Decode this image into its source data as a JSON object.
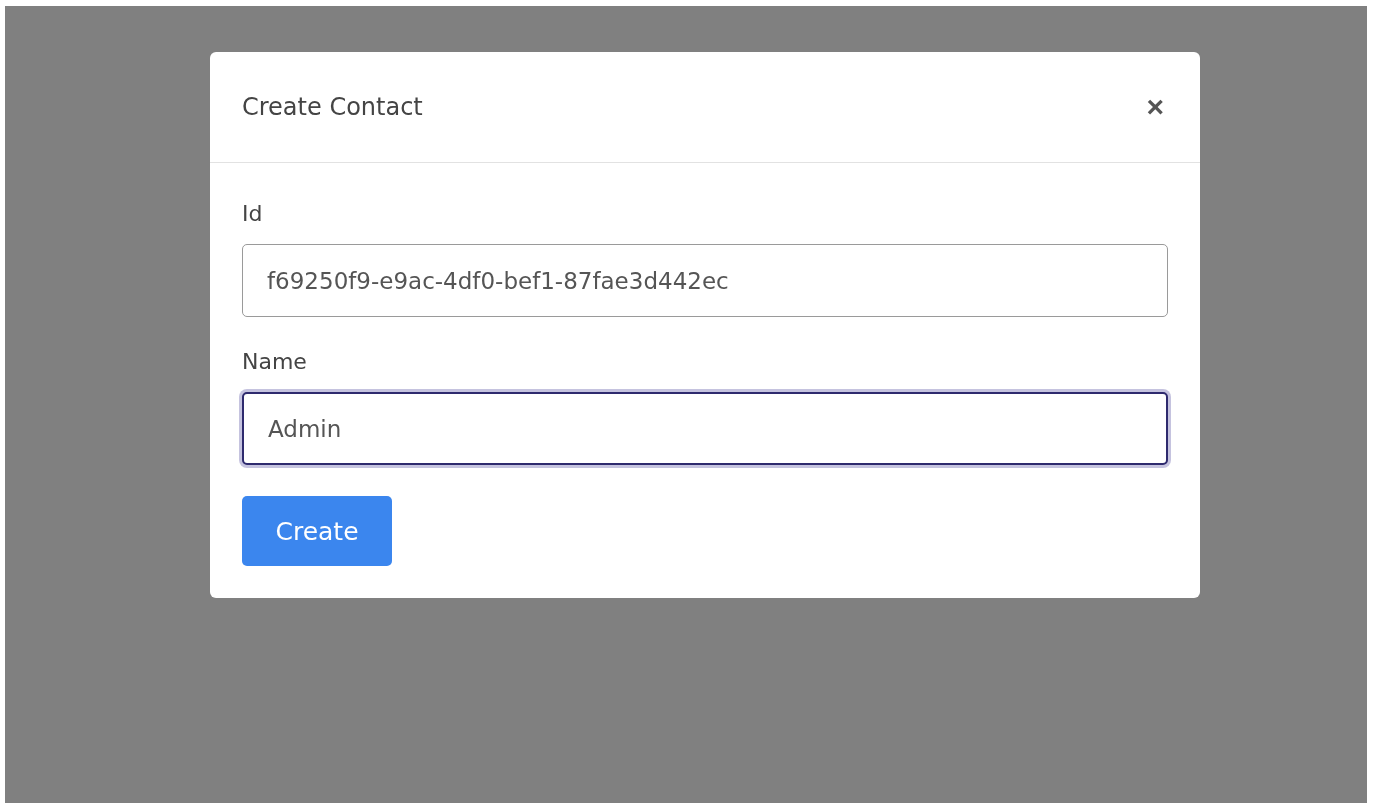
{
  "dialog": {
    "title": "Create Contact",
    "close": "×"
  },
  "fields": [
    {
      "label": "Id",
      "value": "f69250f9-e9ac-4df0-bef1-87fae3d442ec",
      "focused": false
    },
    {
      "label": "Name",
      "value": "Admin",
      "focused": true
    }
  ],
  "buttons": [
    "Create"
  ]
}
